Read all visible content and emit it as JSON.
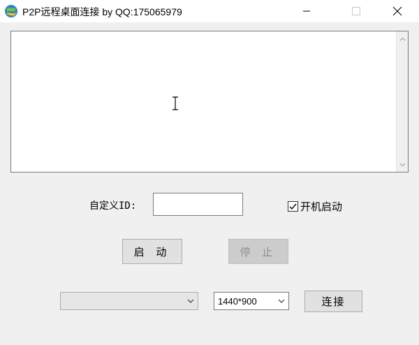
{
  "window": {
    "title": "P2P远程桌面连接 by QQ:175065979"
  },
  "log": {
    "text": ""
  },
  "form": {
    "id_label": "自定义ID:",
    "id_value": "",
    "autostart_label": "开机启动",
    "autostart_checked": true
  },
  "buttons": {
    "start_label": "启 动",
    "stop_label": "停 止",
    "connect_label": "连接"
  },
  "connect": {
    "peer_selected": "",
    "resolution_selected": "1440*900"
  },
  "colors": {
    "window_bg": "#f0f0f0",
    "disabled_button_bg": "#cccccc",
    "disabled_text": "#8d8d8d"
  }
}
